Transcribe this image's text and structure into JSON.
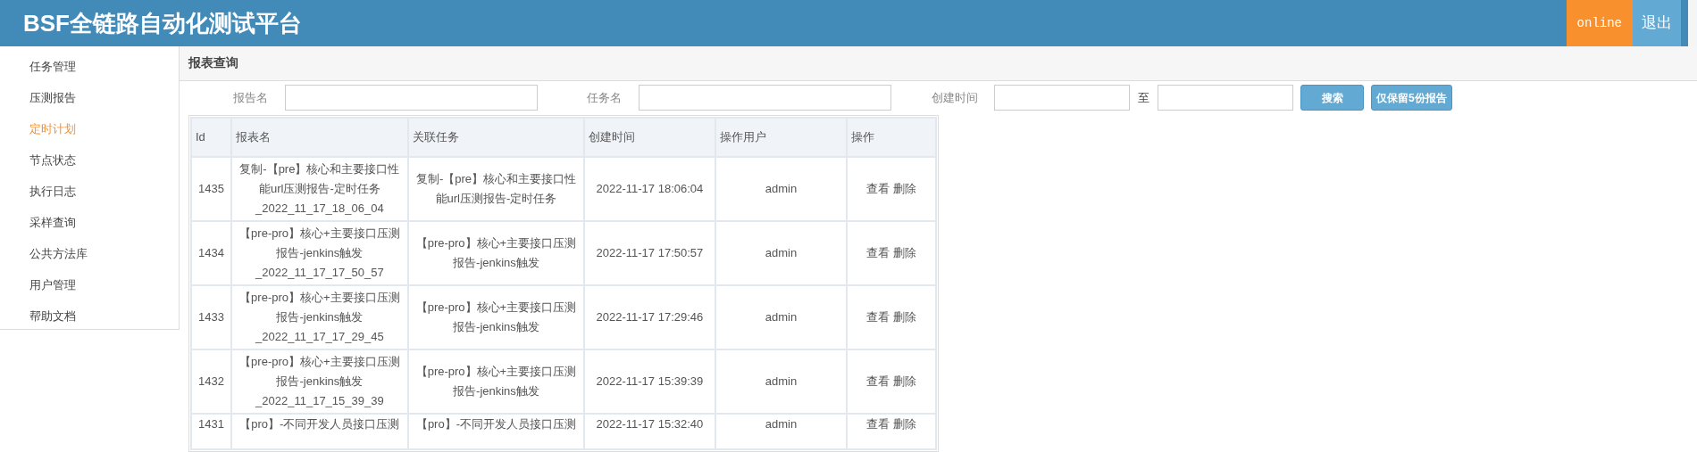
{
  "header": {
    "title": "BSF全链路自动化测试平台",
    "status": "online",
    "logout": "退出"
  },
  "sidebar": {
    "items": [
      {
        "label": "任务管理",
        "selected": false
      },
      {
        "label": "压测报告",
        "selected": false
      },
      {
        "label": "定时计划",
        "selected": true
      },
      {
        "label": "节点状态",
        "selected": false
      },
      {
        "label": "执行日志",
        "selected": false
      },
      {
        "label": "采样查询",
        "selected": false
      },
      {
        "label": "公共方法库",
        "selected": false
      },
      {
        "label": "用户管理",
        "selected": false
      },
      {
        "label": "帮助文档",
        "selected": false
      }
    ]
  },
  "panel": {
    "title": "报表查询"
  },
  "filters": {
    "report_name": "报告名",
    "task_name": "任务名",
    "created": "创建时间",
    "to": "至",
    "search": "搜索",
    "keep5": "仅保留5份报告"
  },
  "table": {
    "columns": [
      "Id",
      "报表名",
      "关联任务",
      "创建时间",
      "操作用户",
      "操作"
    ],
    "rows": [
      {
        "id": "1435",
        "name": "复制-【pre】核心和主要接口性能url压测报告-定时任务_2022_11_17_18_06_04",
        "task": "复制-【pre】核心和主要接口性能url压测报告-定时任务",
        "created": "2022-11-17 18:06:04",
        "user": "admin",
        "view": "查看",
        "delete": "删除"
      },
      {
        "id": "1434",
        "name": "【pre-pro】核心+主要接口压测报告-jenkins触发_2022_11_17_17_50_57",
        "task": "【pre-pro】核心+主要接口压测报告-jenkins触发",
        "created": "2022-11-17 17:50:57",
        "user": "admin",
        "view": "查看",
        "delete": "删除"
      },
      {
        "id": "1433",
        "name": "【pre-pro】核心+主要接口压测报告-jenkins触发_2022_11_17_17_29_45",
        "task": "【pre-pro】核心+主要接口压测报告-jenkins触发",
        "created": "2022-11-17 17:29:46",
        "user": "admin",
        "view": "查看",
        "delete": "删除"
      },
      {
        "id": "1432",
        "name": "【pre-pro】核心+主要接口压测报告-jenkins触发_2022_11_17_15_39_39",
        "task": "【pre-pro】核心+主要接口压测报告-jenkins触发",
        "created": "2022-11-17 15:39:39",
        "user": "admin",
        "view": "查看",
        "delete": "删除"
      },
      {
        "id": "1431",
        "name": "【pro】-不同开发人员接口压测",
        "task": "【pro】-不同开发人员接口压测",
        "created": "2022-11-17 15:32:40",
        "user": "admin",
        "view": "查看",
        "delete": "删除"
      }
    ]
  }
}
